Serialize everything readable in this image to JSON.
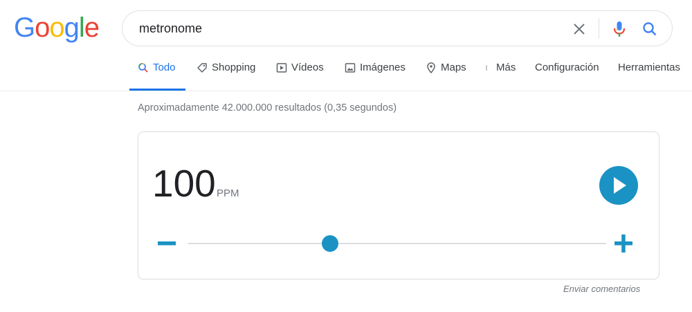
{
  "logo": {
    "letters": [
      "G",
      "o",
      "o",
      "g",
      "l",
      "e"
    ]
  },
  "search": {
    "query": "metronome",
    "clear_icon": "close-icon",
    "mic_icon": "microphone-icon",
    "search_icon": "search-icon"
  },
  "tabs": [
    {
      "label": "Todo",
      "icon": "search-icon",
      "active": true
    },
    {
      "label": "Shopping",
      "icon": "tag-icon"
    },
    {
      "label": "Vídeos",
      "icon": "video-icon"
    },
    {
      "label": "Imágenes",
      "icon": "image-icon"
    },
    {
      "label": "Maps",
      "icon": "map-pin-icon"
    },
    {
      "label": "Más",
      "icon": "more-vertical-icon"
    },
    {
      "label": "Configuración"
    },
    {
      "label": "Herramientas"
    }
  ],
  "result_stats": "Aproximadamente 42.000.000 resultados (0,35 segundos)",
  "metronome": {
    "bpm": "100",
    "unit": "PPM",
    "slider_fraction": 0.34,
    "accent_color": "#1a93c4"
  },
  "feedback_label": "Enviar comentarios"
}
